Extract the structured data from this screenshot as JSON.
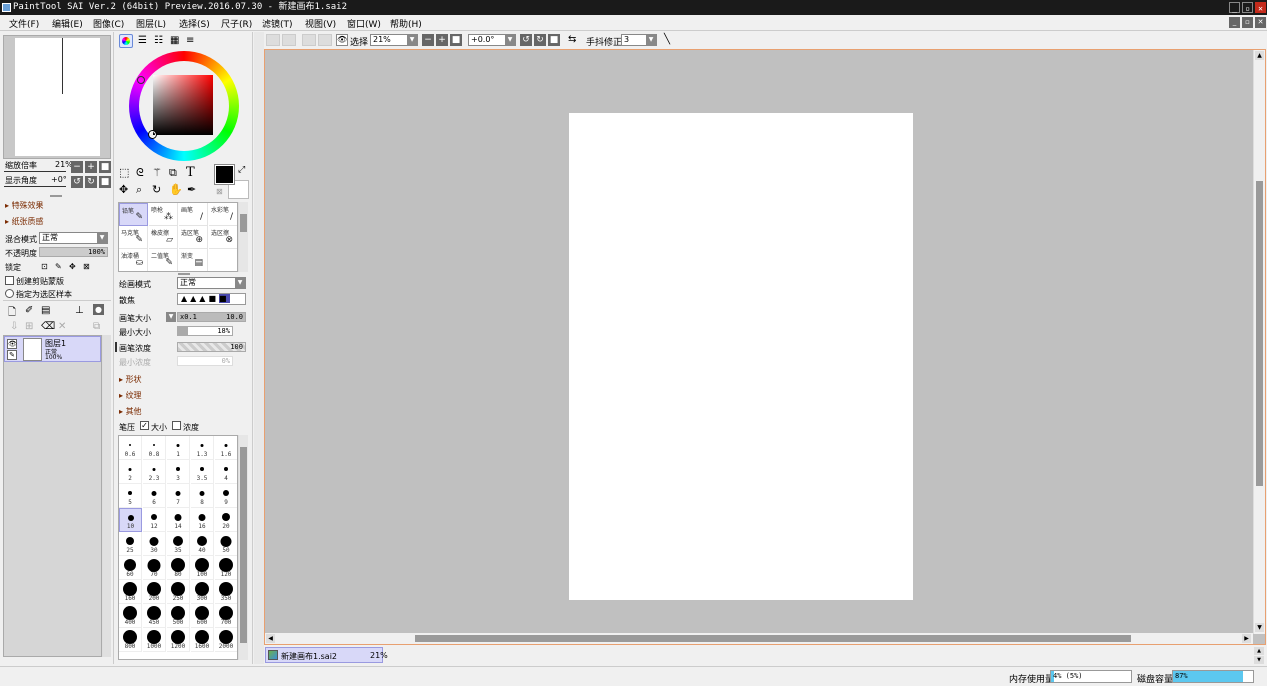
{
  "window": {
    "title": "PaintTool SAI Ver.2 (64bit) Preview.2016.07.30 - 新建画布1.sai2",
    "min": "_",
    "max": "▫",
    "close": "✕"
  },
  "menu": [
    "文件(F)",
    "编辑(E)",
    "图像(C)",
    "图层(L)",
    "选择(S)",
    "尺子(R)",
    "滤镜(T)",
    "视图(V)",
    "窗口(W)",
    "帮助(H)"
  ],
  "navigator": {
    "zoom_label": "缩放倍率",
    "zoom_value": "21%",
    "angle_label": "显示角度",
    "angle_value": "+0°"
  },
  "layer_panel": {
    "special_effects": "特殊效果",
    "texture": "纸张质感",
    "blend_label": "混合模式",
    "blend_value": "正常",
    "opacity_label": "不透明度",
    "opacity_value": "100%",
    "opacity_fraction": 1.0,
    "lock_label": "锁定",
    "clip_label": "创建剪贴蒙版",
    "sel_source_label": "指定为选区样本",
    "layer": {
      "name": "图层1",
      "mode": "正常",
      "opacity": "100%"
    }
  },
  "tools": [
    {
      "name": "铅笔",
      "icon": "✎"
    },
    {
      "name": "喷枪",
      "icon": "⁂"
    },
    {
      "name": "画笔",
      "icon": "/"
    },
    {
      "name": "水彩笔",
      "icon": "/"
    },
    {
      "name": "马克笔",
      "icon": "✎"
    },
    {
      "name": "橡皮擦",
      "icon": "▱"
    },
    {
      "name": "选区笔",
      "icon": "⊕"
    },
    {
      "name": "选区擦",
      "icon": "⊗"
    },
    {
      "name": "油漆桶",
      "icon": "⛀"
    },
    {
      "name": "二值笔",
      "icon": "✎"
    },
    {
      "name": "渐变",
      "icon": "▤"
    }
  ],
  "brush": {
    "draw_mode_label": "绘画模式",
    "draw_mode_value": "正常",
    "edge_label": "散焦",
    "size_label": "画笔大小",
    "size_mult": "x0.1",
    "size_value": "10.0",
    "size_fraction": 1.0,
    "min_size_label": "最小大小",
    "min_size_value": "18%",
    "min_size_fraction": 0.18,
    "density_label": "画笔浓度",
    "density_value": "100",
    "density_fraction": 1.0,
    "min_density_label": "最小浓度",
    "min_density_value": "0%",
    "shape": "形状",
    "texture": "纹理",
    "other": "其他",
    "pressure_label": "笔压",
    "pressure_size": "大小",
    "pressure_density": "浓度",
    "presets": [
      "0.6",
      "0.8",
      "1",
      "1.3",
      "1.6",
      "2",
      "2.3",
      "3",
      "3.5",
      "4",
      "5",
      "6",
      "7",
      "8",
      "9",
      "10",
      "12",
      "14",
      "16",
      "20",
      "25",
      "30",
      "35",
      "40",
      "50",
      "60",
      "70",
      "80",
      "100",
      "120",
      "160",
      "200",
      "250",
      "300",
      "350",
      "400",
      "450",
      "500",
      "600",
      "700",
      "800",
      "1000",
      "1200",
      "1600",
      "2000"
    ],
    "selected": "10"
  },
  "toolbar": {
    "select_label": "选择",
    "zoom_value": "21%",
    "rotate_value": "+0.0°",
    "stabilizer_label": "手抖修正",
    "stabilizer_value": "3"
  },
  "tab": {
    "name": "新建画布1.sai2",
    "zoom": "21%"
  },
  "status": {
    "mem_label": "内存使用量",
    "mem_value": "4% (5%)",
    "mem_fraction": 0.04,
    "disk_label": "磁盘容量",
    "disk_value": "87%",
    "disk_fraction": 0.87
  },
  "colors": {
    "accent": "#5cc8f0",
    "selected_bg": "#d8d8f8",
    "canvas_bg": "#c0c0c0",
    "section_text": "#7a2a00"
  }
}
